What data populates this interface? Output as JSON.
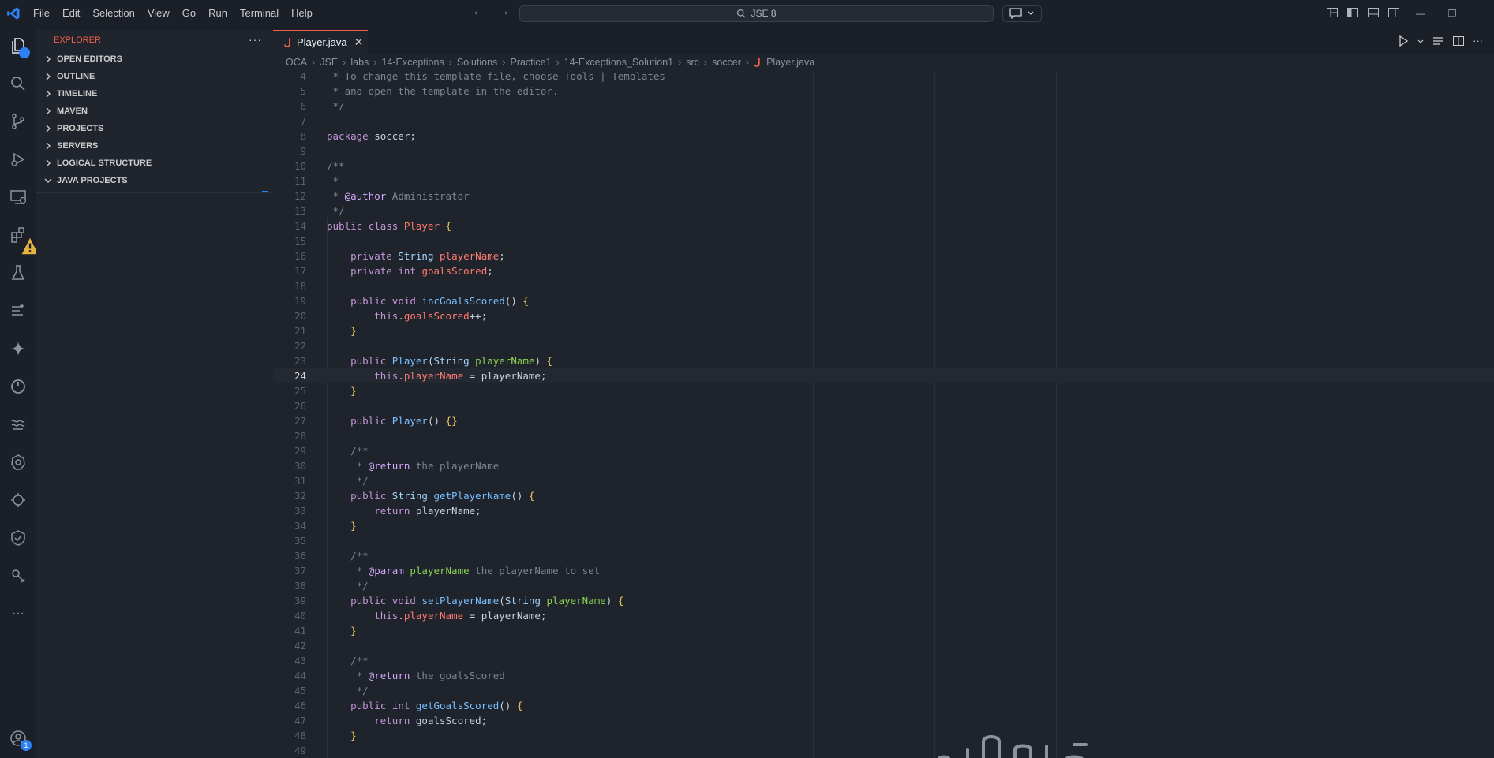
{
  "menu": [
    "File",
    "Edit",
    "Selection",
    "View",
    "Go",
    "Run",
    "Terminal",
    "Help"
  ],
  "command_center": {
    "label": "JSE 8"
  },
  "sidebar": {
    "title": "EXPLORER",
    "more": "···",
    "sections": [
      "OPEN EDITORS",
      "OUTLINE",
      "TIMELINE",
      "MAVEN",
      "PROJECTS",
      "SERVERS",
      "LOGICAL STRUCTURE",
      "JAVA PROJECTS"
    ]
  },
  "activity_badges": {
    "explorer": "",
    "accounts": "1"
  },
  "tab": {
    "label": "Player.java",
    "close": "✕"
  },
  "breadcrumb": [
    "OCA",
    "JSE",
    "labs",
    "14-Exceptions",
    "Solutions",
    "Practice1",
    "14-Exceptions_Solution1",
    "src",
    "soccer",
    "Player.java"
  ],
  "line_numbers": [
    "4",
    "5",
    "6",
    "7",
    "8",
    "9",
    "10",
    "11",
    "12",
    "13",
    "14",
    "15",
    "16",
    "17",
    "18",
    "19",
    "20",
    "21",
    "22",
    "23",
    "24",
    "25",
    "26",
    "27",
    "28",
    "29",
    "30",
    "31",
    "32",
    "33",
    "34",
    "35",
    "36",
    "37",
    "38",
    "39",
    "40",
    "41",
    "42",
    "43",
    "44",
    "45",
    "46",
    "47",
    "48",
    "49"
  ],
  "code": [
    " * To change this template file, choose Tools | Templates",
    " * and open the template in the editor.",
    " */",
    "",
    "package soccer;",
    "",
    "/**",
    " *",
    " * @author Administrator",
    " */",
    "public class Player {",
    "",
    "    private String playerName;",
    "    private int goalsScored;",
    "",
    "    public void incGoalsScored() {",
    "        this.goalsScored++;",
    "    }",
    "",
    "    public Player(String playerName) {",
    "        this.playerName = playerName;",
    "    }",
    "",
    "    public Player() {}",
    "",
    "    /**",
    "     * @return the playerName",
    "     */",
    "    public String getPlayerName() {",
    "        return playerName;",
    "    }",
    "",
    "    /**",
    "     * @param playerName the playerName to set",
    "     */",
    "    public void setPlayerName(String playerName) {",
    "        this.playerName = playerName;",
    "    }",
    "",
    "    /**",
    "     * @return the goalsScored",
    "     */",
    "    public int getGoalsScored() {",
    "        return goalsScored;",
    "    }",
    "",
    "}"
  ],
  "cursor_line": "24",
  "colors": {
    "accent": "#f2604c",
    "bg": "#1f232b",
    "keyword": "#c397d8"
  }
}
